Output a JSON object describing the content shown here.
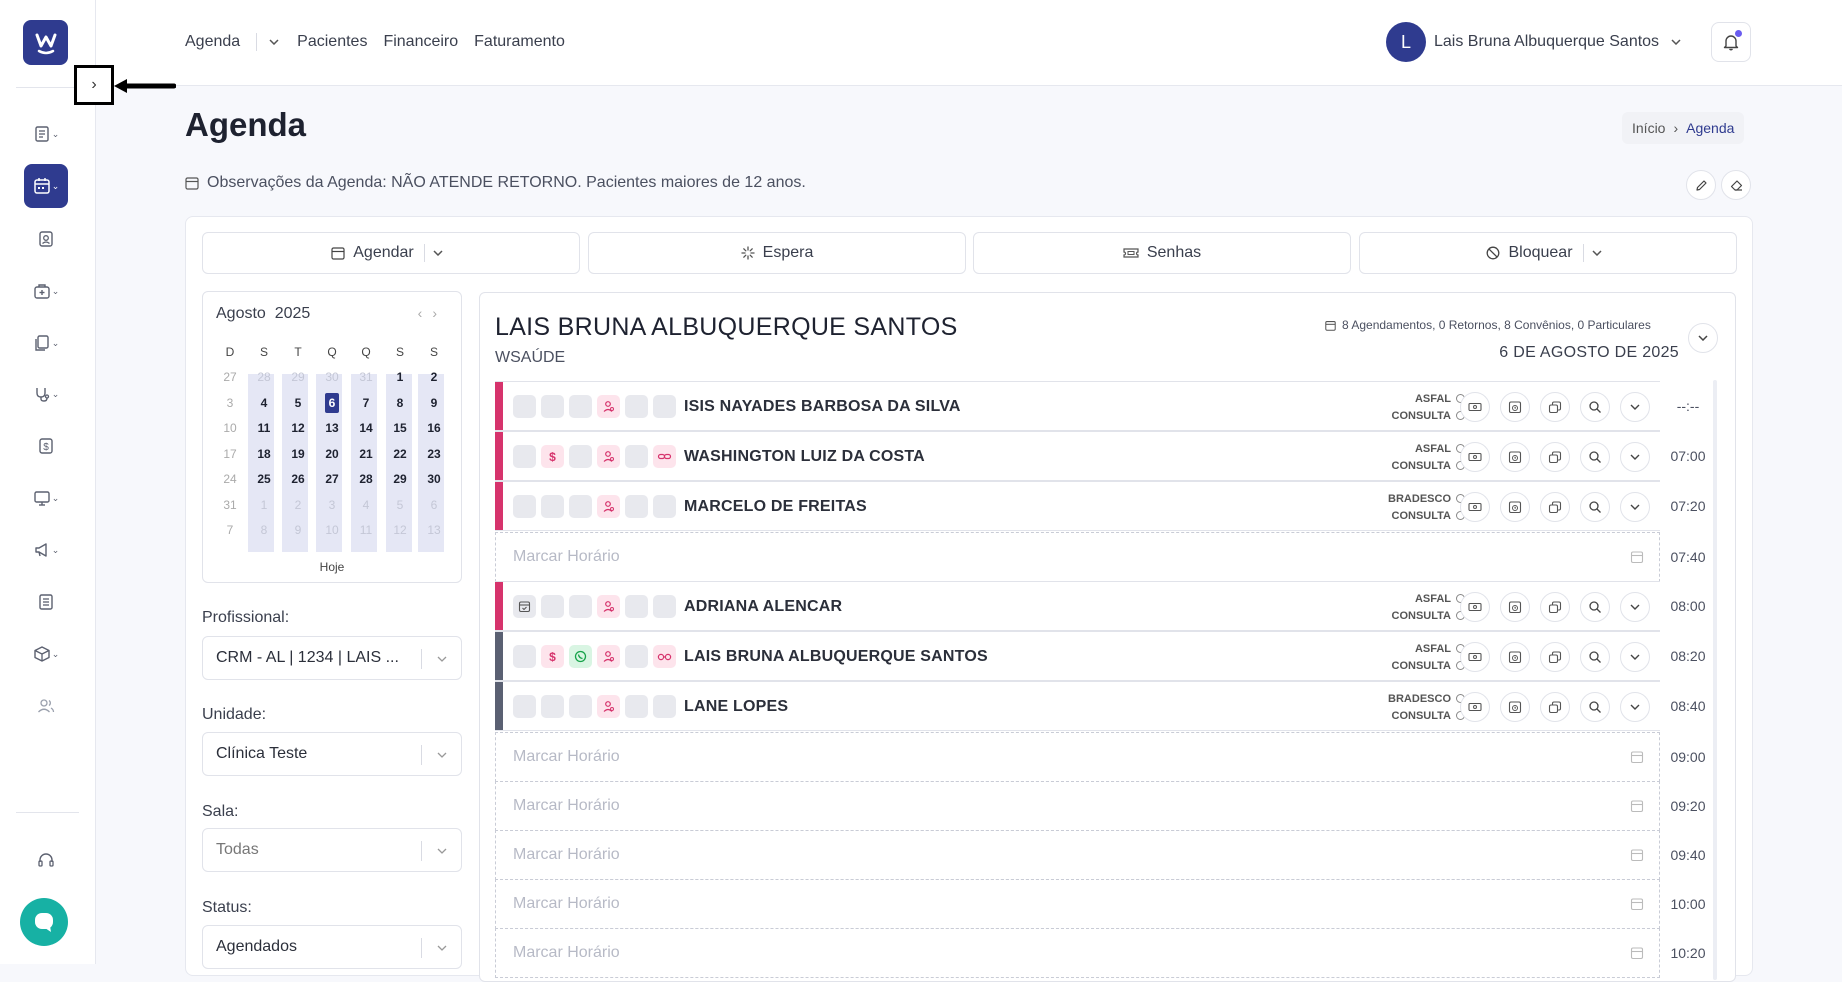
{
  "nav": {
    "agenda": "Agenda",
    "pacientes": "Pacientes",
    "financeiro": "Financeiro",
    "faturamento": "Faturamento"
  },
  "user": {
    "initial": "L",
    "name": "Lais Bruna Albuquerque Santos"
  },
  "page": {
    "title": "Agenda",
    "breadcrumb_home": "Início",
    "breadcrumb_current": "Agenda",
    "observations": "Observações da Agenda: NÃO ATENDE RETORNO. Pacientes maiores de 12 anos."
  },
  "toolbar": {
    "agendar": "Agendar",
    "espera": "Espera",
    "senhas": "Senhas",
    "bloquear": "Bloquear"
  },
  "calendar": {
    "month": "Agosto",
    "year": "2025",
    "weekdays": [
      "D",
      "S",
      "T",
      "Q",
      "Q",
      "S",
      "S"
    ],
    "weeks": [
      [
        "27",
        "28",
        "29",
        "30",
        "31",
        "1",
        "2"
      ],
      [
        "3",
        "4",
        "5",
        "6",
        "7",
        "8",
        "9"
      ],
      [
        "10",
        "11",
        "12",
        "13",
        "14",
        "15",
        "16"
      ],
      [
        "17",
        "18",
        "19",
        "20",
        "21",
        "22",
        "23"
      ],
      [
        "24",
        "25",
        "26",
        "27",
        "28",
        "29",
        "30"
      ],
      [
        "31",
        "1",
        "2",
        "3",
        "4",
        "5",
        "6"
      ],
      [
        "7",
        "8",
        "9",
        "10",
        "11",
        "12",
        "13"
      ]
    ],
    "selected_day": "6",
    "today_label": "Hoje"
  },
  "filters": {
    "profissional_label": "Profissional:",
    "profissional_value": "CRM - AL | 1234 | LAIS ...",
    "unidade_label": "Unidade:",
    "unidade_value": "Clínica Teste",
    "sala_label": "Sala:",
    "sala_value": "Todas",
    "status_label": "Status:",
    "status_value": "Agendados"
  },
  "schedule": {
    "doctor": "LAIS BRUNA ALBUQUERQUE SANTOS",
    "org": "WSAÚDE",
    "summary": "8 Agendamentos, 0 Retornos, 8 Convênios, 0 Particulares",
    "date": "6 DE AGOSTO DE 2025",
    "empty_slot_label": "Marcar Horário",
    "appointments": [
      {
        "name": "ISIS NAYADES BARBOSA DA SILVA",
        "plan": "ASFAL",
        "type": "CONSULTA",
        "time": "--:--",
        "color": "#d6336c"
      },
      {
        "name": "WASHINGTON LUIZ DA COSTA",
        "plan": "ASFAL",
        "type": "CONSULTA",
        "time": "07:00",
        "color": "#d6336c"
      },
      {
        "name": "MARCELO DE FREITAS",
        "plan": "BRADESCO",
        "type": "CONSULTA",
        "time": "07:20",
        "color": "#d6336c"
      },
      {
        "name": "ADRIANA ALENCAR",
        "plan": "ASFAL",
        "type": "CONSULTA",
        "time": "08:00",
        "color": "#d6336c"
      },
      {
        "name": "LAIS BRUNA ALBUQUERQUE SANTOS",
        "plan": "ASFAL",
        "type": "CONSULTA",
        "time": "08:20",
        "color": "#5a6072"
      },
      {
        "name": "LANE LOPES",
        "plan": "BRADESCO",
        "type": "CONSULTA",
        "time": "08:40",
        "color": "#5a6072"
      }
    ],
    "slot_times": [
      "07:40",
      "09:00",
      "09:20",
      "09:40",
      "10:00",
      "10:20"
    ]
  },
  "icons": {
    "logo": "w-logo-icon",
    "collapse": "chevron-right-icon",
    "bell": "bell-icon",
    "chat": "chat-icon"
  }
}
